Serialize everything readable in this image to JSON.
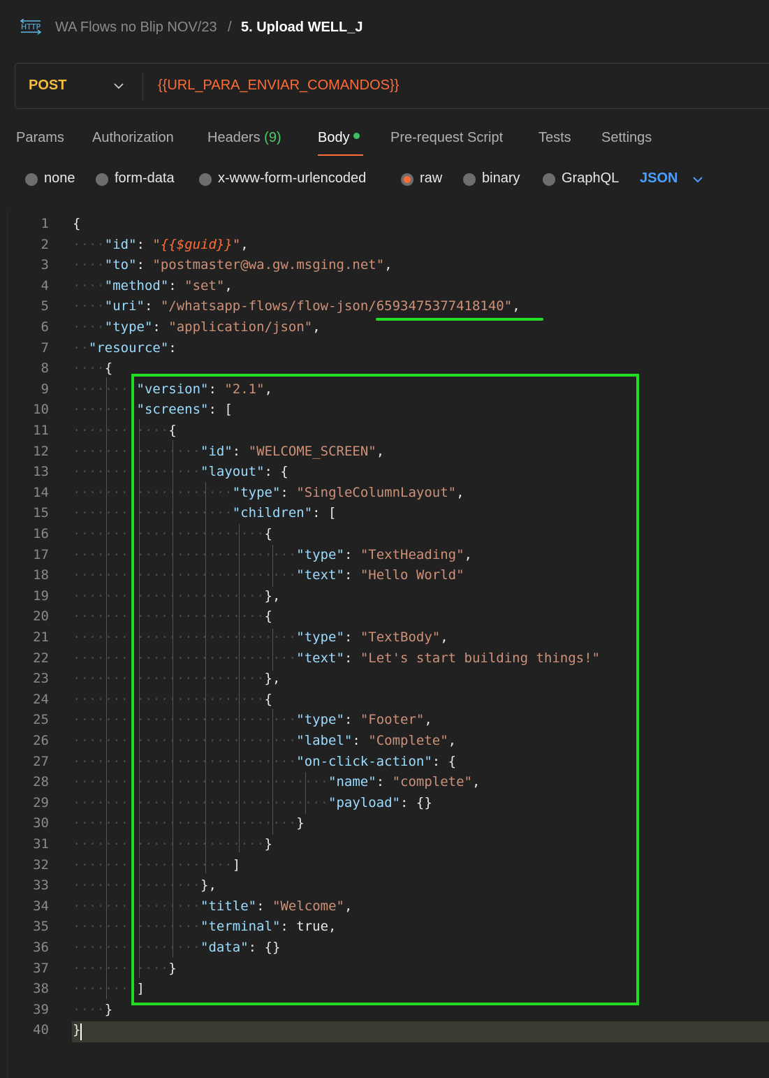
{
  "breadcrumb": {
    "icon": "http-icon",
    "collection": "WA Flows no Blip NOV/23",
    "separator": "/",
    "request": "5. Upload WELL_J"
  },
  "request": {
    "method": "POST",
    "url": "{{URL_PARA_ENVIAR_COMANDOS}}"
  },
  "tabs": {
    "params": "Params",
    "authorization": "Authorization",
    "headers": "Headers",
    "headers_count": "(9)",
    "body": "Body",
    "prerequest": "Pre-request Script",
    "tests": "Tests",
    "settings": "Settings",
    "active": "Body"
  },
  "body_types": {
    "none": "none",
    "form_data": "form-data",
    "urlencoded": "x-www-form-urlencoded",
    "raw": "raw",
    "binary": "binary",
    "graphql": "GraphQL",
    "selected": "raw",
    "language": "JSON"
  },
  "line_numbers": [
    "1",
    "2",
    "3",
    "4",
    "5",
    "6",
    "7",
    "8",
    "9",
    "10",
    "11",
    "12",
    "13",
    "14",
    "15",
    "16",
    "17",
    "18",
    "19",
    "20",
    "21",
    "22",
    "23",
    "24",
    "25",
    "26",
    "27",
    "28",
    "29",
    "30",
    "31",
    "32",
    "33",
    "34",
    "35",
    "36",
    "37",
    "38",
    "39",
    "40"
  ],
  "code_lines": [
    "{",
    "    \"id\": \"{{$guid}}\",",
    "    \"to\": \"postmaster@wa.gw.msging.net\",",
    "    \"method\": \"set\",",
    "    \"uri\": \"/whatsapp-flows/flow-json/6593475377418140\",",
    "    \"type\": \"application/json\",",
    "  \"resource\":",
    "    {",
    "        \"version\": \"2.1\",",
    "        \"screens\": [",
    "            {",
    "                \"id\": \"WELCOME_SCREEN\",",
    "                \"layout\": {",
    "                    \"type\": \"SingleColumnLayout\",",
    "                    \"children\": [",
    "                        {",
    "                            \"type\": \"TextHeading\",",
    "                            \"text\": \"Hello World\"",
    "                        },",
    "                        {",
    "                            \"type\": \"TextBody\",",
    "                            \"text\": \"Let's start building things!\"",
    "                        },",
    "                        {",
    "                            \"type\": \"Footer\",",
    "                            \"label\": \"Complete\",",
    "                            \"on-click-action\": {",
    "                                \"name\": \"complete\",",
    "                                \"payload\": {}",
    "                            }",
    "                        }",
    "                    ]",
    "                },",
    "                \"title\": \"Welcome\",",
    "                \"terminal\": true,",
    "                \"data\": {}",
    "            }",
    "        ]",
    "    }",
    "}"
  ],
  "annotations": {
    "underline_color": "#22dd22",
    "box_color": "#22dd22"
  },
  "colors": {
    "method": "#f5bc3d",
    "url_variable": "#ff6c37",
    "key": "#9cdcfe",
    "string": "#ce9178",
    "language": "#4a9eff",
    "tab_count": "#4ec96a"
  }
}
